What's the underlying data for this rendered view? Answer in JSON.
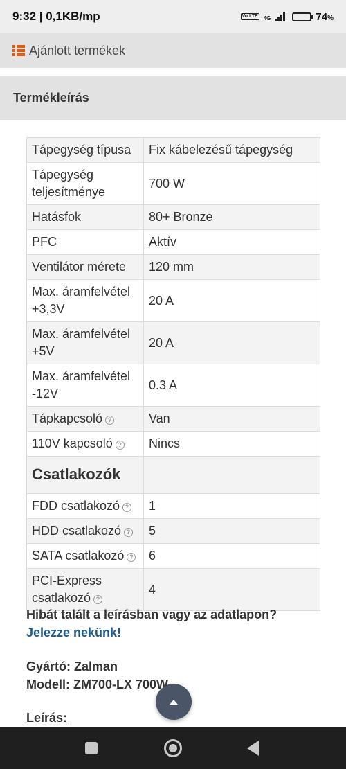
{
  "status_bar": {
    "time_speed": "9:32 | 0,1KB/mp",
    "volte": "Vo LTE",
    "network": "4G",
    "battery_percent": "74",
    "battery_unit": "%",
    "battery_level": 0.74
  },
  "top_link": {
    "label": "Ajánlott termékek",
    "icon": "list-icon",
    "accent_color": "#e8590c"
  },
  "section": {
    "title": "Termékleírás"
  },
  "specs": {
    "rows": [
      {
        "key": "Tápegység típusa",
        "value": "Fix kábelezésű tápegység"
      },
      {
        "key": "Tápegység teljesítménye",
        "value": "700 W"
      },
      {
        "key": "Hatásfok",
        "value": "80+ Bronze"
      },
      {
        "key": "PFC",
        "value": "Aktív"
      },
      {
        "key": "Ventilátor mérete",
        "value": "120 mm"
      },
      {
        "key": "Max. áramfelvétel +3,3V",
        "value": "20 A"
      },
      {
        "key": "Max. áramfelvétel +5V",
        "value": "20 A"
      },
      {
        "key": "Max. áramfelvétel -12V",
        "value": "0.3 A"
      },
      {
        "key": "Tápkapcsoló",
        "value": "Van"
      },
      {
        "key": "110V kapcsoló",
        "value": "Nincs"
      }
    ],
    "group_title": "Csatlakozók",
    "connector_rows": [
      {
        "key": "FDD csatlakozó",
        "value": "1"
      },
      {
        "key": "HDD csatlakozó",
        "value": "5"
      },
      {
        "key": "SATA csatlakozó",
        "value": "6"
      },
      {
        "key": "PCI-Express csatlakozó",
        "value": "4"
      }
    ],
    "help_glyph": "?"
  },
  "report": {
    "question": "Hibát talált a leírásban vagy az adatlapon?",
    "link": "Jelezze nekünk!",
    "link_color": "#1d5a8f"
  },
  "maker": {
    "manufacturer": "Gyártó: Zalman",
    "model": "Modell: ZM700-LX 700W"
  },
  "description_label": "Leírás:",
  "scroll_top_icon": "chevron-up-icon"
}
